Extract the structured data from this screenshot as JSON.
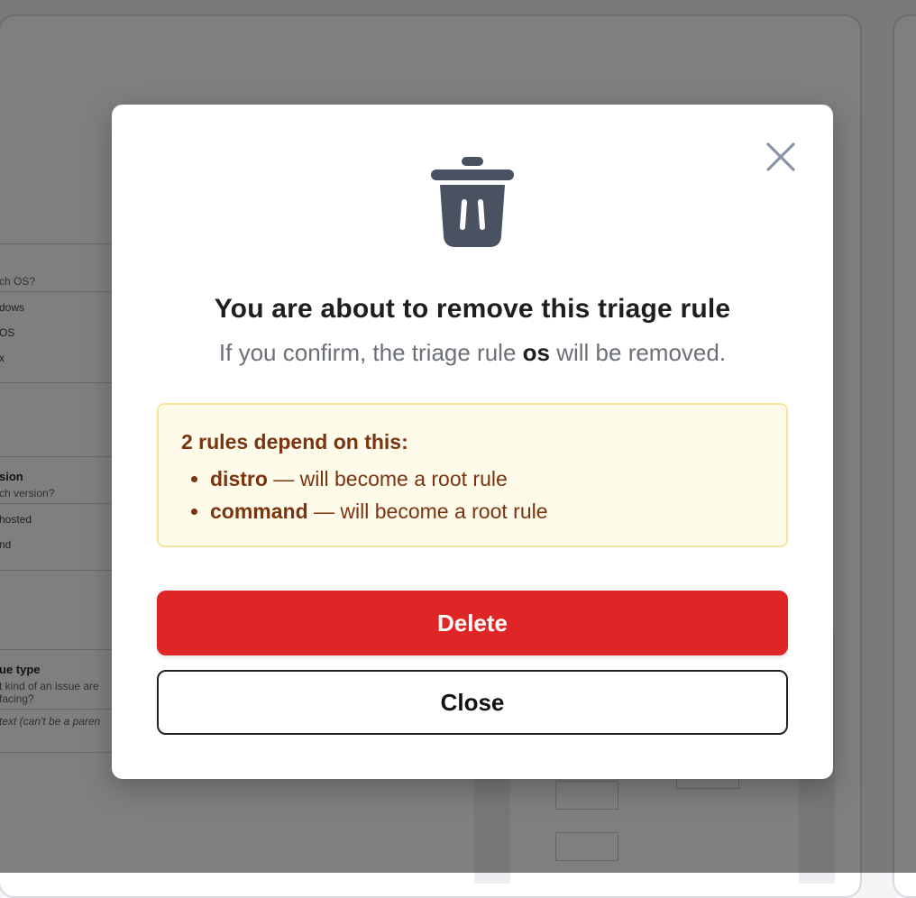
{
  "background": {
    "cards": [
      {
        "question": "ch OS?",
        "options": [
          "dows",
          "OS",
          "x"
        ]
      },
      {
        "title": "sion",
        "question": "ch version?",
        "options": [
          "hosted",
          "nd"
        ]
      },
      {
        "title": "ue type",
        "question": "t kind of an issue are",
        "question2": "facing?",
        "note": "text (can't be a paren"
      }
    ]
  },
  "modal": {
    "close_icon": "close-x-icon",
    "trash_icon": "trash-can-icon",
    "title": "You are about to remove this triage rule",
    "subtitle_prefix": "If you confirm, the triage rule",
    "subtitle_rule": "os",
    "subtitle_suffix": "will be removed.",
    "warning": {
      "heading": "2 rules depend on this:",
      "items": [
        {
          "name": "distro",
          "suffix": " — will become a root rule"
        },
        {
          "name": "command",
          "suffix": " — will become a root rule"
        }
      ]
    },
    "delete_label": "Delete",
    "close_label": "Close"
  },
  "colors": {
    "danger": "#df2627",
    "warning_bg": "#fefbea",
    "warning_border": "#f7e49a",
    "warning_text": "#7a3410",
    "icon": "#4a5161"
  }
}
